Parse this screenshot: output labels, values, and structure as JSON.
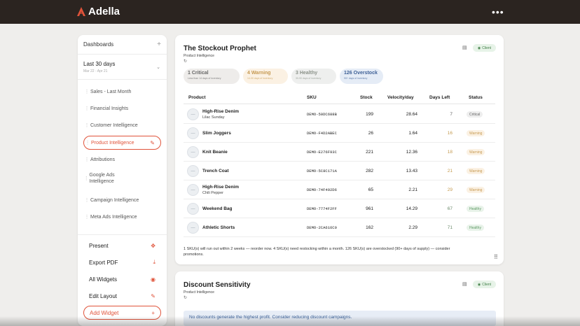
{
  "app": {
    "name": "Adella",
    "more_label": "•••"
  },
  "sidebar": {
    "header": "Dashboards",
    "header_add": "+",
    "range_title": "Last 30 days",
    "range_dates": "Mar 22 - Apr 21",
    "nav": [
      {
        "label": "Sales - Last Month"
      },
      {
        "label": "Financial Insights"
      },
      {
        "label": "Customer Intelligence"
      },
      {
        "label": "Product Intelligence",
        "active": true
      },
      {
        "label": "Attributions"
      },
      {
        "label": "Google Ads Intelligence"
      },
      {
        "label": "Campaign Intelligence"
      },
      {
        "label": "Meta Ads Intelligence"
      }
    ],
    "actions": [
      {
        "label": "Present",
        "icon": "expand-icon"
      },
      {
        "label": "Export PDF",
        "icon": "download-icon"
      },
      {
        "label": "All Widgets",
        "icon": "eye-icon"
      },
      {
        "label": "Edit Layout",
        "icon": "edit-layout-icon"
      }
    ],
    "add_widget": "Add Widget",
    "add_widget_icon": "+"
  },
  "stockout": {
    "title": "The Stockout Prophet",
    "subtitle": "Product Intelligence",
    "badge": "Client",
    "chips": [
      {
        "count": "1 Critical",
        "desc": "Less than 14 days of inventory"
      },
      {
        "count": "4 Warning",
        "desc": "14-30 days of inventory"
      },
      {
        "count": "3 Healthy",
        "desc": "30-90 days of inventory"
      },
      {
        "count": "126 Overstock",
        "desc": "90+ days of inventory"
      }
    ],
    "columns": [
      "Product",
      "SKU",
      "Stock",
      "Velocity/day",
      "Days Left",
      "Status"
    ],
    "rows": [
      {
        "name": "High-Rise Denim",
        "variant": "Lilac Sunday",
        "sku": "DEMO-50DC688B",
        "stock": "199",
        "velocity": "28.64",
        "days": "7",
        "status": "Critical",
        "level": "crit"
      },
      {
        "name": "Slim Joggers",
        "variant": "",
        "sku": "DEMO-F4D2ABEC",
        "stock": "26",
        "velocity": "1.64",
        "days": "16",
        "status": "Warning",
        "level": "warn"
      },
      {
        "name": "Knit Beanie",
        "variant": "",
        "sku": "DEMO-E276F93C",
        "stock": "221",
        "velocity": "12.36",
        "days": "18",
        "status": "Warning",
        "level": "warn"
      },
      {
        "name": "Trench Coat",
        "variant": "",
        "sku": "DEMO-5C8C171A",
        "stock": "282",
        "velocity": "13.43",
        "days": "21",
        "status": "Warning",
        "level": "warn"
      },
      {
        "name": "High-Rise Denim",
        "variant": "Chili Pepper",
        "sku": "DEMO-74F492D6",
        "stock": "65",
        "velocity": "2.21",
        "days": "29",
        "status": "Warning",
        "level": "warn"
      },
      {
        "name": "Weekend Bag",
        "variant": "",
        "sku": "DEMO-7774F2FF",
        "stock": "961",
        "velocity": "14.29",
        "days": "67",
        "status": "Healthy",
        "level": "heal"
      },
      {
        "name": "Athletic Shorts",
        "variant": "",
        "sku": "DEMO-2CA616C0",
        "stock": "162",
        "velocity": "2.29",
        "days": "71",
        "status": "Healthy",
        "level": "heal"
      }
    ],
    "summary": "1 SKU(s) will run out within 2 weeks — reorder now. 4 SKU(s) need restocking within a month. 126 SKU(s) are overstocked (90+ days of supply) — consider promotions."
  },
  "discount": {
    "title": "Discount Sensitivity",
    "subtitle": "Product Intelligence",
    "badge": "Client",
    "banner": "No discounts generate the highest profit. Consider reducing discount campaigns."
  },
  "colors": {
    "accent": "#e0533a",
    "topbar": "#2b2420",
    "healthy": "#5e9a64",
    "warning": "#c69a52"
  }
}
